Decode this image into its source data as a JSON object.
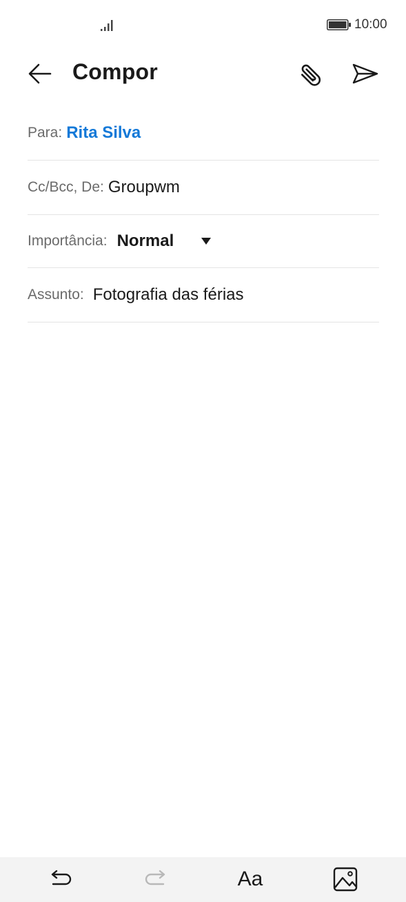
{
  "status_bar": {
    "time": "10:00",
    "signal_icon": "signal-bars-icon",
    "battery_icon": "battery-full-icon"
  },
  "header": {
    "title": "Compor",
    "back_icon": "arrow-left-icon",
    "attach_icon": "paperclip-icon",
    "send_icon": "send-icon"
  },
  "form": {
    "to": {
      "label": "Para:",
      "value": "Rita Silva"
    },
    "cc": {
      "label": "Cc/Bcc, De:",
      "value": "Groupwm"
    },
    "importance": {
      "label": "Importância:",
      "value": "Normal"
    },
    "subject": {
      "label": "Assunto:",
      "value": "Fotografia das férias"
    }
  },
  "toolbar": {
    "undo_icon": "undo-icon",
    "redo_icon": "redo-icon",
    "format_label": "Aa",
    "image_icon": "image-icon"
  },
  "colors": {
    "accent": "#1479d8",
    "text": "#1a1a1a",
    "label": "#6b6b6b",
    "divider": "#e4e4e4",
    "toolbar_bg": "#f3f3f3"
  }
}
